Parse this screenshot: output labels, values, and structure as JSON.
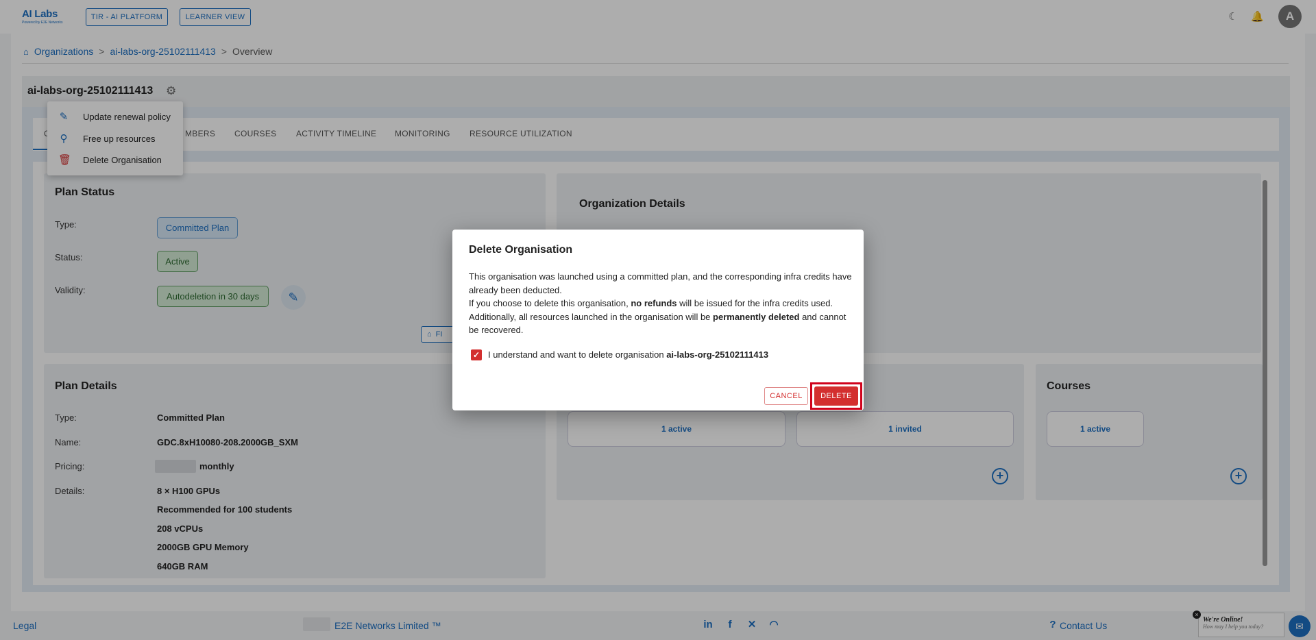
{
  "header": {
    "logo_brand": "AI Labs",
    "logo_tagline": "Powered by E2E Networks",
    "tir_button": "TIR - AI PLATFORM",
    "learner_button": "LEARNER VIEW",
    "avatar_letter": "A"
  },
  "breadcrumb": {
    "home": "Organizations",
    "sep": ">",
    "org": "ai-labs-org-25102111413",
    "current": "Overview"
  },
  "org": {
    "title": "ai-labs-org-25102111413"
  },
  "menu": {
    "items": [
      {
        "label": "Update renewal policy"
      },
      {
        "label": "Free up resources"
      },
      {
        "label": "Delete Organisation"
      }
    ]
  },
  "tabs": {
    "overview_partial": "O",
    "members_partial": "MBERS",
    "courses": "COURSES",
    "activity": "ACTIVITY TIMELINE",
    "monitoring": "MONITORING",
    "resource": "RESOURCE UTILIZATION"
  },
  "plan_status": {
    "title": "Plan Status",
    "type_label": "Type:",
    "type_value": "Committed Plan",
    "status_label": "Status:",
    "status_value": "Active",
    "validity_label": "Validity:",
    "validity_value": "Autodeletion in 30 days",
    "free_partial": "FI"
  },
  "org_details": {
    "title": "Organization Details"
  },
  "plan_details": {
    "title": "Plan Details",
    "type_label": "Type:",
    "type_value": "Committed Plan",
    "name_label": "Name:",
    "name_value": "GDC.8xH10080-208.2000GB_SXM",
    "pricing_label": "Pricing:",
    "pricing_value": "monthly",
    "details_label": "Details:",
    "details": [
      "8 × H100 GPUs",
      "Recommended for 100 students",
      "208 vCPUs",
      "2000GB GPU Memory",
      "640GB RAM"
    ]
  },
  "members": {
    "active": "1 active",
    "invited": "1 invited"
  },
  "courses": {
    "title": "Courses",
    "active": "1 active"
  },
  "footer": {
    "legal": "Legal",
    "company": "E2E Networks Limited ™",
    "contact": "Contact Us",
    "chat_title": "We're Online!",
    "chat_sub": "How may I help you today?"
  },
  "dialog": {
    "title": "Delete Organisation",
    "line1": "This organisation was launched using a committed plan, and the corresponding infra credits have already been deducted.",
    "line2_pre": "If you choose to delete this organisation, ",
    "line2_bold": "no refunds",
    "line2_post": " will be issued for the infra credits used.",
    "line3_pre": "Additionally, all resources launched in the organisation will be ",
    "line3_bold": "permanently deleted",
    "line3_post": " and cannot be recovered.",
    "confirm_pre": "I understand and want to delete organisation ",
    "confirm_org": "ai-labs-org-25102111413",
    "cancel": "CANCEL",
    "delete": "DELETE"
  },
  "colors": {
    "accent": "#1c6fc2",
    "danger": "#d32f2f"
  }
}
